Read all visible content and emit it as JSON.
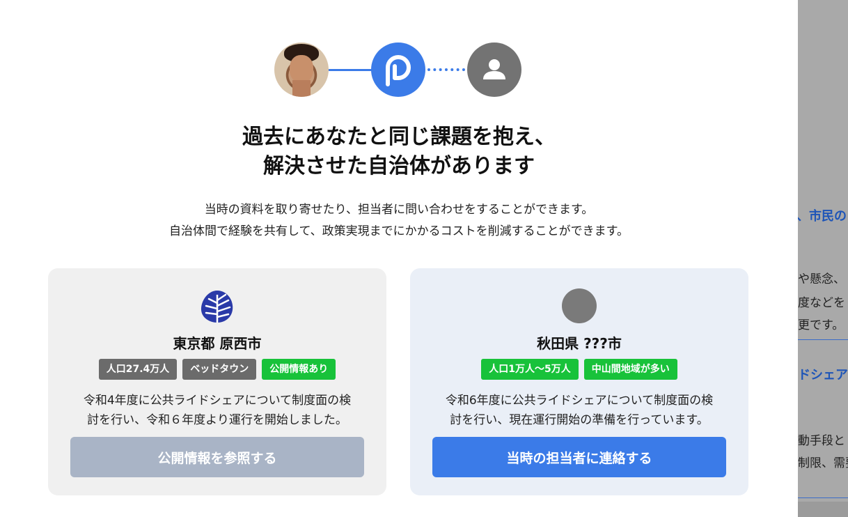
{
  "hero": {
    "user_avatar": "user-photo",
    "brand_icon": "brand-logo-icon",
    "contact_icon": "person-icon"
  },
  "headline": {
    "line1": "過去にあなたと同じ課題を抱え、",
    "line2": "解決させた自治体があります"
  },
  "subtext": {
    "line1": "当時の資料を取り寄せたり、担当者に問い合わせをすることができます。",
    "line2": "自治体間で経験を共有して、政策実現までにかかるコストを削減することができます。"
  },
  "cards": [
    {
      "name": "東京都 原西市",
      "tags": [
        {
          "label": "人口27.4万人",
          "color": "#6b6b6b"
        },
        {
          "label": "ベッドタウン",
          "color": "#6b6b6b"
        },
        {
          "label": "公開情報あり",
          "color": "#18c23a"
        }
      ],
      "desc_line1": "令和4年度に公共ライドシェアについて制度面の検",
      "desc_line2": "討を行い、令和６年度より運行を開始しました。",
      "button": "公開情報を参照する",
      "button_color": "#a9b4c6"
    },
    {
      "name": "秋田県 ???市",
      "tags": [
        {
          "label": "人口1万人〜5万人",
          "color": "#18c23a"
        },
        {
          "label": "中山間地域が多い",
          "color": "#18c23a"
        }
      ],
      "desc_line1": "令和6年度に公共ライドシェアについて制度面の検",
      "desc_line2": "討を行い、現在運行開始の準備を行っています。",
      "button": "当時の担当者に連絡する",
      "button_color": "#3b7be8"
    }
  ],
  "background_page": {
    "line1": "、市民の",
    "line2": "や懸念、",
    "line3": "度などを",
    "line4": "更です。",
    "line5": "ドシェア",
    "line6": "動手段と",
    "line7": "制限、需要"
  },
  "colors": {
    "accent": "#3b7be8",
    "tag_green": "#18c23a",
    "tag_gray": "#6b6b6b"
  }
}
